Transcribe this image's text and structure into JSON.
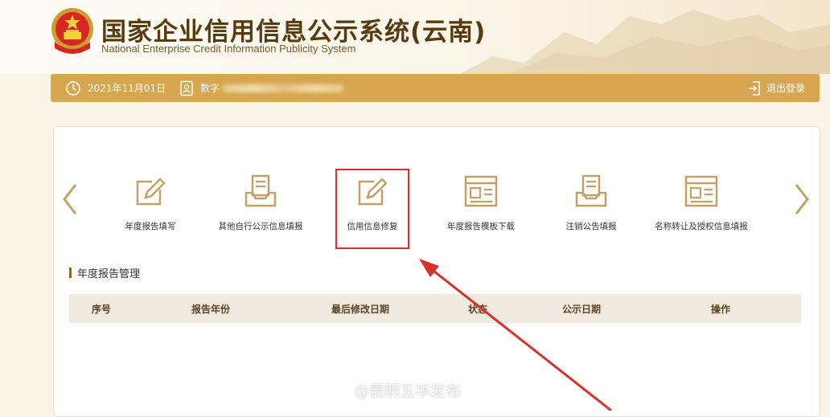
{
  "header": {
    "title": "国家企业信用信息公示系统(云南)",
    "subtitle": "National Enterprise Credit Information Publicity System"
  },
  "infobar": {
    "date": "2021年11月01日",
    "account_prefix": "数字",
    "logout_label": "退出登录"
  },
  "functions": [
    {
      "label": "年度报告填写",
      "icon": "edit-icon"
    },
    {
      "label": "其他自行公示信息填报",
      "icon": "tray-document-icon"
    },
    {
      "label": "信用信息修复",
      "icon": "edit-icon"
    },
    {
      "label": "年度报告模板下载",
      "icon": "template-icon"
    },
    {
      "label": "注销公告填报",
      "icon": "tray-document-icon"
    },
    {
      "label": "名称转让及授权信息填报",
      "icon": "template-icon"
    }
  ],
  "section": {
    "title": "年度报告管理"
  },
  "table": {
    "columns": [
      "序号",
      "报告年份",
      "最后修改日期",
      "状态",
      "公示日期",
      "操作"
    ]
  },
  "watermark": "@昆明五华发布",
  "colors": {
    "accent": "#d8a64f",
    "highlight": "#d9302a",
    "icon": "#c4a064"
  }
}
